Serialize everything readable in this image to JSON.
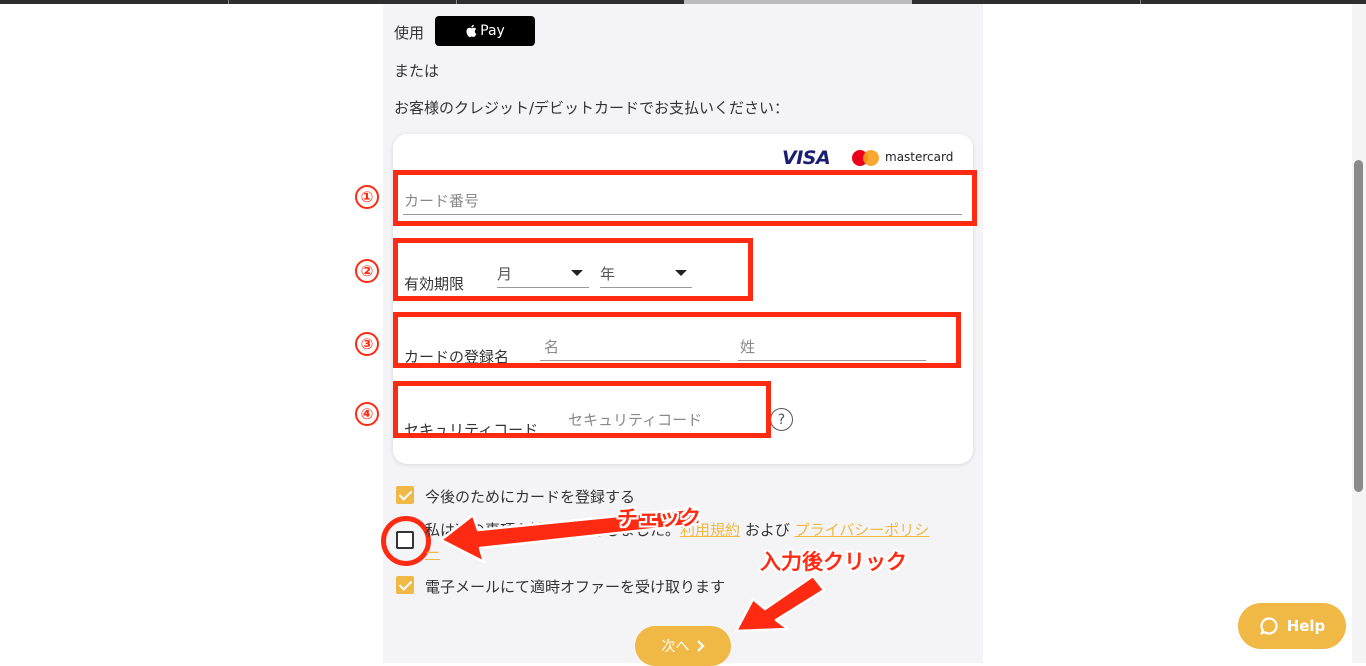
{
  "payment": {
    "use_label": "使用",
    "apple_pay_label": "Pay",
    "or_label": "または",
    "card_instruction": "お客様のクレジット/デビットカードでお支払いください：",
    "brands": {
      "visa": "VISA",
      "mastercard": "mastercard"
    },
    "card_number_placeholder": "カード番号",
    "expiry_label": "有効期限",
    "expiry_month_value": "月",
    "expiry_year_value": "年",
    "cardholder_label": "カードの登録名",
    "first_name_placeholder": "名",
    "last_name_placeholder": "姓",
    "security_code_label": "セキュリティコード",
    "security_code_placeholder": "セキュリティコード",
    "help_mark": "?"
  },
  "options": {
    "save_card_label": "今後のためにカードを登録する",
    "terms_prefix": "私は次の事項を読み、同意しました。",
    "terms_link": "利用規約",
    "terms_and": "および",
    "privacy_link_line1": "プライバシーポリシ",
    "privacy_link_line2": "ー",
    "email_offers_label": "電子メールにて適時オファーを受け取ります"
  },
  "annotations": {
    "step1": "①",
    "step2": "②",
    "step3": "③",
    "step4": "④",
    "check_note": "チェック",
    "click_note": "入力後クリック"
  },
  "buttons": {
    "next_label": "次へ",
    "help_label": "Help"
  },
  "colors": {
    "accent": "#f0b845",
    "annotation_red": "#ff2a12",
    "visa_blue": "#1a1f71"
  }
}
